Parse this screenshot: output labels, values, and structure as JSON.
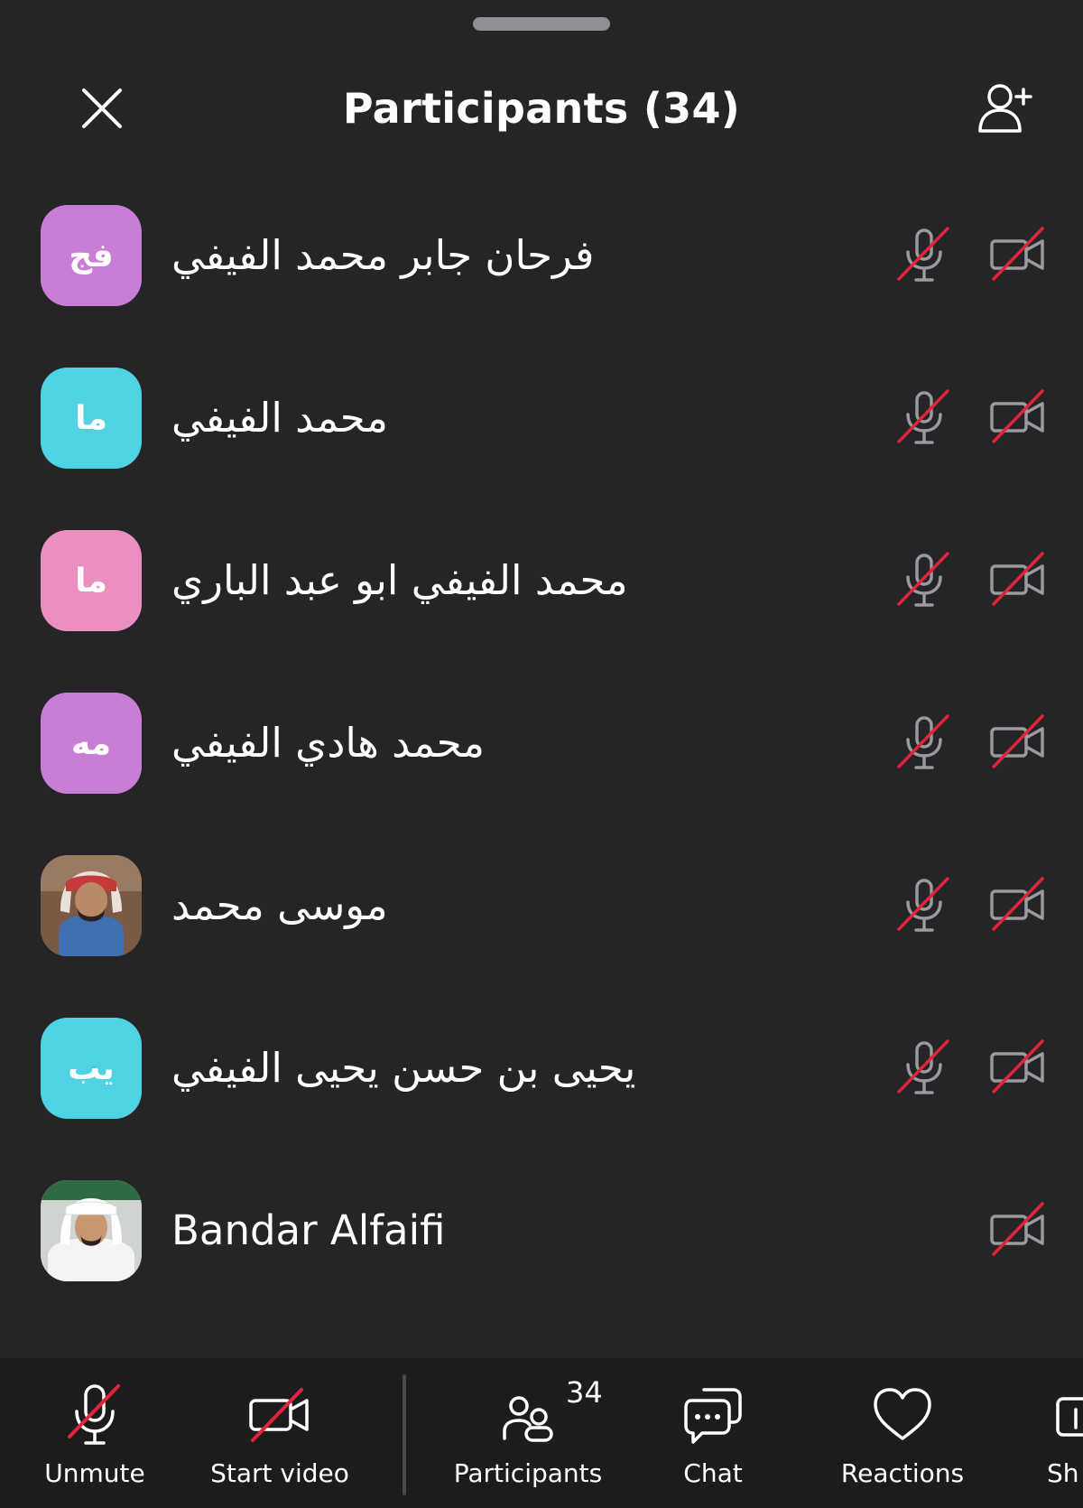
{
  "header": {
    "title": "Participants (34)",
    "close_icon": "close-icon",
    "invite_icon": "add-person-icon"
  },
  "participants": [
    {
      "name": "فرحان جابر محمد الفيفي",
      "initials": "فج",
      "avatar_color": "#c97ed6",
      "avatar_type": "initials",
      "mic_muted": true,
      "video_off": true
    },
    {
      "name": "محمد الفيفي",
      "initials": "ما",
      "avatar_color": "#4fd2e2",
      "avatar_type": "initials",
      "mic_muted": true,
      "video_off": true
    },
    {
      "name": "محمد الفيفي ابو عبد الباري",
      "initials": "ما",
      "avatar_color": "#ea8fc0",
      "avatar_type": "initials",
      "mic_muted": true,
      "video_off": true
    },
    {
      "name": "محمد هادي الفيفي",
      "initials": "مه",
      "avatar_color": "#c97ed6",
      "avatar_type": "initials",
      "mic_muted": true,
      "video_off": true
    },
    {
      "name": "موسى محمد",
      "initials": "",
      "avatar_color": "#8a6a55",
      "avatar_type": "photo",
      "mic_muted": true,
      "video_off": true
    },
    {
      "name": "يحيى بن حسن يحيى الفيفي",
      "initials": "يب",
      "avatar_color": "#4fd2e2",
      "avatar_type": "initials",
      "mic_muted": true,
      "video_off": true
    },
    {
      "name": "Bandar Alfaifi",
      "initials": "",
      "avatar_color": "#d7d7d7",
      "avatar_type": "photo",
      "mic_muted": false,
      "video_off": true
    }
  ],
  "toolbar": {
    "unmute_label": "Unmute",
    "start_video_label": "Start video",
    "participants_label": "Participants",
    "participants_count": "34",
    "chat_label": "Chat",
    "reactions_label": "Reactions",
    "share_label": "Sh"
  },
  "colors": {
    "background": "#252527",
    "toolbar_background": "#1c1c1e",
    "muted_slash": "#e0243a",
    "icon_gray": "#9a9a9e"
  }
}
